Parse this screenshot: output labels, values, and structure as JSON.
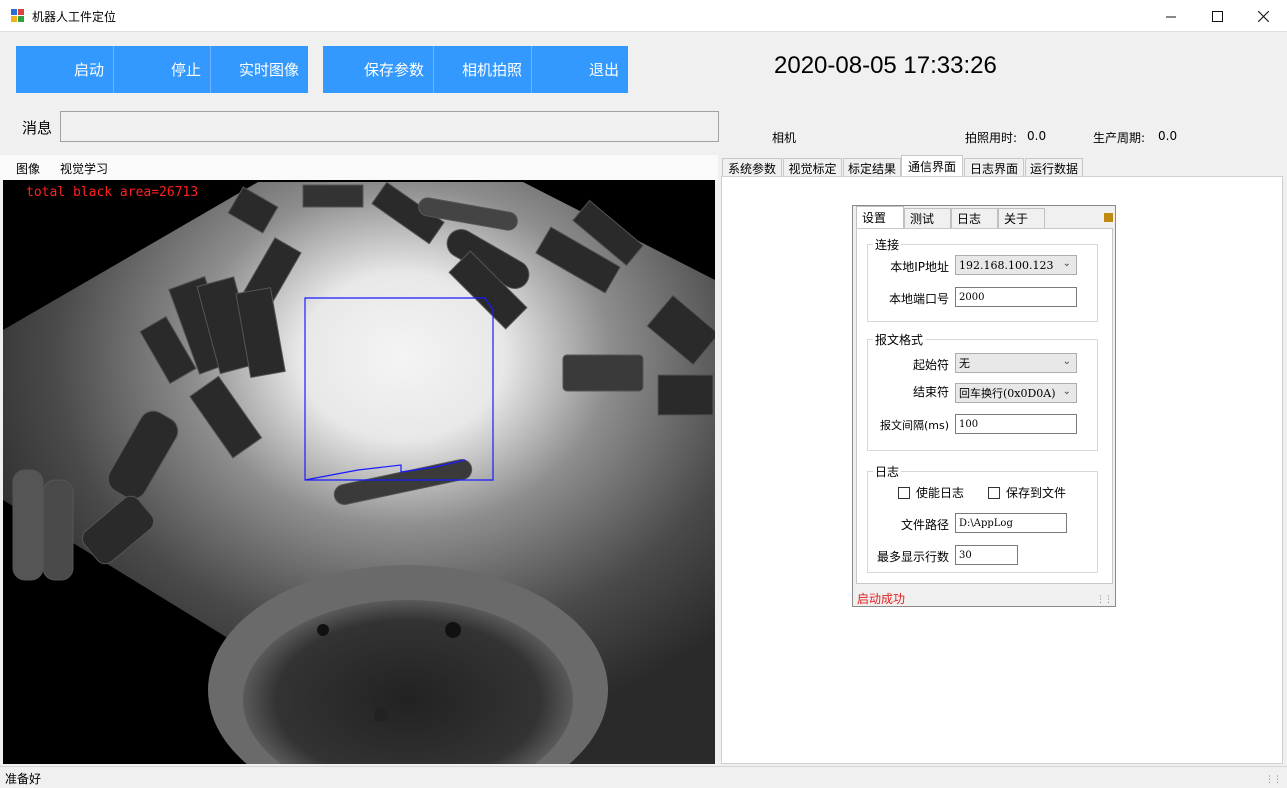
{
  "window": {
    "title": "机器人工件定位",
    "minimize_icon": "minimize-icon",
    "maximize_icon": "maximize-icon",
    "close_icon": "close-icon"
  },
  "toolbar": {
    "start": "启动",
    "stop": "停止",
    "live_image": "实时图像",
    "save_params": "保存参数",
    "camera_capture": "相机拍照",
    "exit": "退出",
    "accent_color": "#3399ff"
  },
  "datetime": "2020-08-05 17:33:26",
  "message": {
    "label": "消息",
    "value": ""
  },
  "info": {
    "camera_label": "相机",
    "capture_time_label": "拍照用时:",
    "capture_time_value": "0.0",
    "cycle_label": "生产周期:",
    "cycle_value": "0.0"
  },
  "left_tabs": [
    "图像",
    "视觉学习"
  ],
  "image_overlay": {
    "text": "total black area=26713",
    "text_color": "#ff2020",
    "roi_color": "#1a1aff"
  },
  "right_tabs": {
    "items": [
      "系统参数",
      "视觉标定",
      "标定结果",
      "通信界面",
      "日志界面",
      "运行数据"
    ],
    "active": "通信界面"
  },
  "comm": {
    "tabs": [
      "设置",
      "测试",
      "日志",
      "关于"
    ],
    "active_tab": "设置",
    "connection": {
      "title": "连接",
      "ip_label": "本地IP地址",
      "ip_value": "192.168.100.123",
      "port_label": "本地端口号",
      "port_value": "2000"
    },
    "format": {
      "title": "报文格式",
      "start_label": "起始符",
      "start_value": "无",
      "end_label": "结束符",
      "end_value": "回车换行(0x0D0A)",
      "interval_label": "报文间隔(ms)",
      "interval_value": "100"
    },
    "log": {
      "title": "日志",
      "enable_label": "使能日志",
      "enable_checked": false,
      "save_label": "保存到文件",
      "save_checked": false,
      "path_label": "文件路径",
      "path_value": "D:\\AppLog",
      "max_lines_label": "最多显示行数",
      "max_lines_value": "30"
    },
    "status": "启动成功",
    "status_color": "#e02020"
  },
  "statusbar": {
    "text": "准备好"
  }
}
